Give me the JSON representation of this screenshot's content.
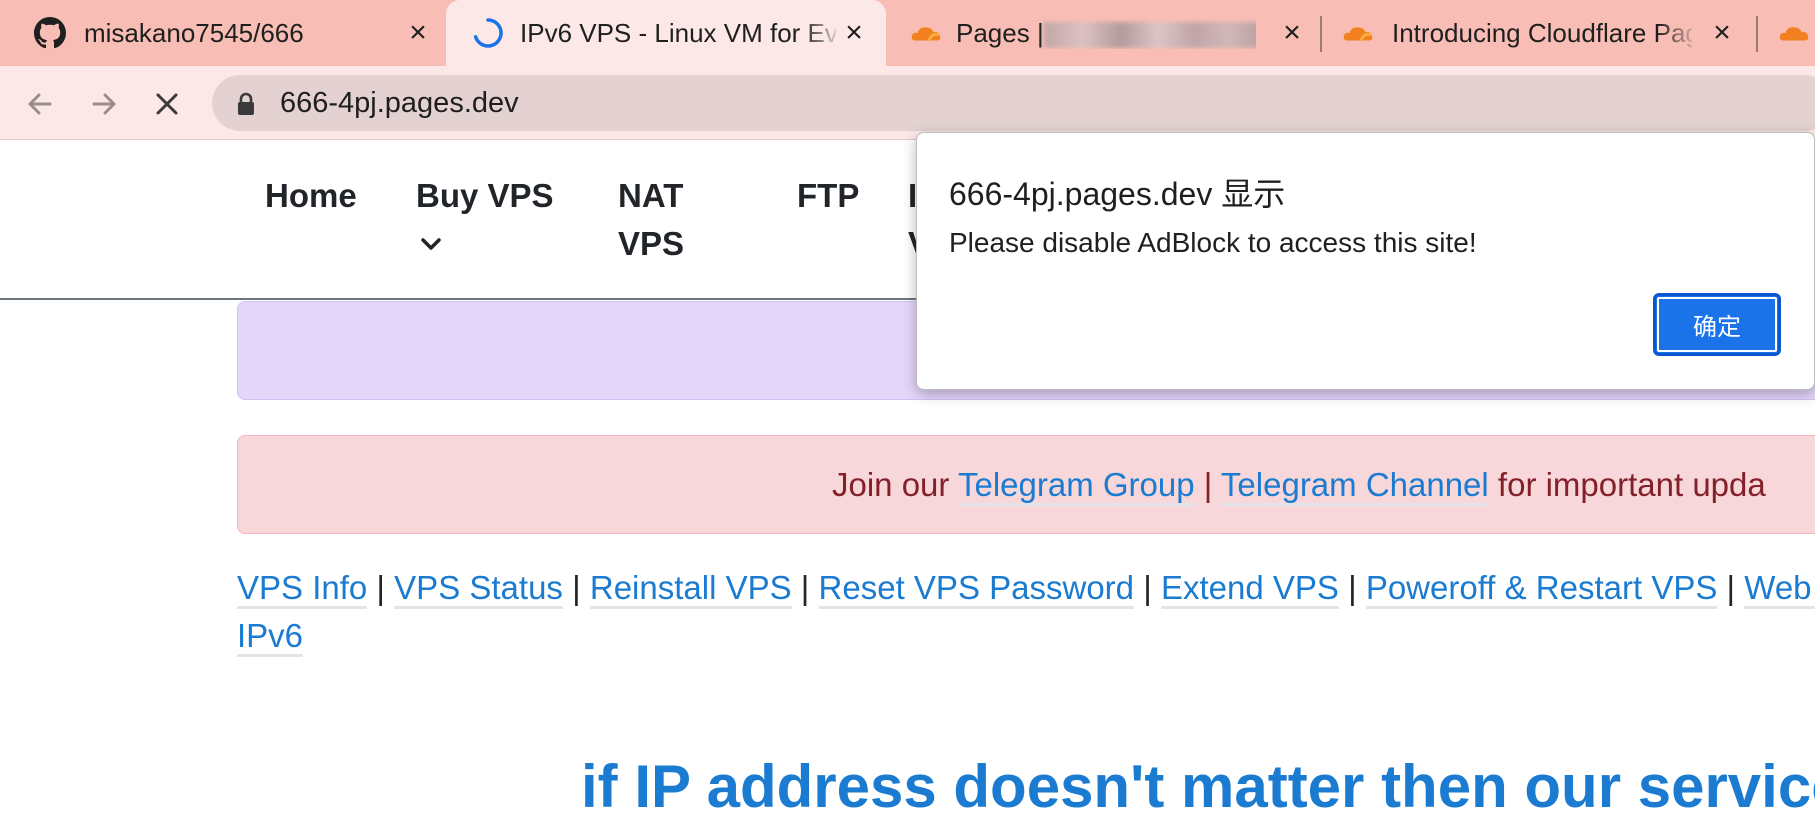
{
  "tabs": [
    {
      "title": "misakano7545/666",
      "icon": "github-icon",
      "active": false
    },
    {
      "title": "IPv6 VPS - Linux VM for Ev",
      "icon": "loading-spinner-icon",
      "active": true
    },
    {
      "title_prefix": "Pages |",
      "title_suffix": "ou",
      "icon": "cloudflare-icon",
      "active": false
    },
    {
      "title": "Introducing Cloudflare Pag",
      "icon": "cloudflare-icon",
      "active": false
    }
  ],
  "toolbar": {
    "url": "666-4pj.pages.dev"
  },
  "nav": {
    "home": "Home",
    "buy_vps": "Buy VPS",
    "nat_line1": "NAT",
    "nat_line2": "VPS",
    "ftp": "FTP",
    "partial1": "I",
    "partial2": "V"
  },
  "announcement": {
    "prefix": "Join our",
    "group_link": "Telegram Group",
    "separator": "|",
    "channel_link": "Telegram Channel",
    "suffix": "for important upda"
  },
  "quick_links": {
    "items": [
      "VPS Info",
      "VPS Status",
      "Reinstall VPS",
      "Reset VPS Password",
      "Extend VPS",
      "Poweroff & Restart VPS",
      "Web I"
    ],
    "second_line": "IPv6",
    "separator": "|"
  },
  "headline": "if IP address doesn't matter then our service",
  "dialog": {
    "title": "666-4pj.pages.dev 显示",
    "message": "Please disable AdBlock to access this site!",
    "ok_label": "确定"
  },
  "colors": {
    "tab_strip": "#f8bdb5",
    "toolbar": "#fce9e7",
    "link": "#1a7bd1",
    "purple_alert": "#e4d6fb",
    "pink_alert": "#f8d7da",
    "dialog_button": "#1a73e8",
    "cloudflare_orange": "#f38020"
  }
}
